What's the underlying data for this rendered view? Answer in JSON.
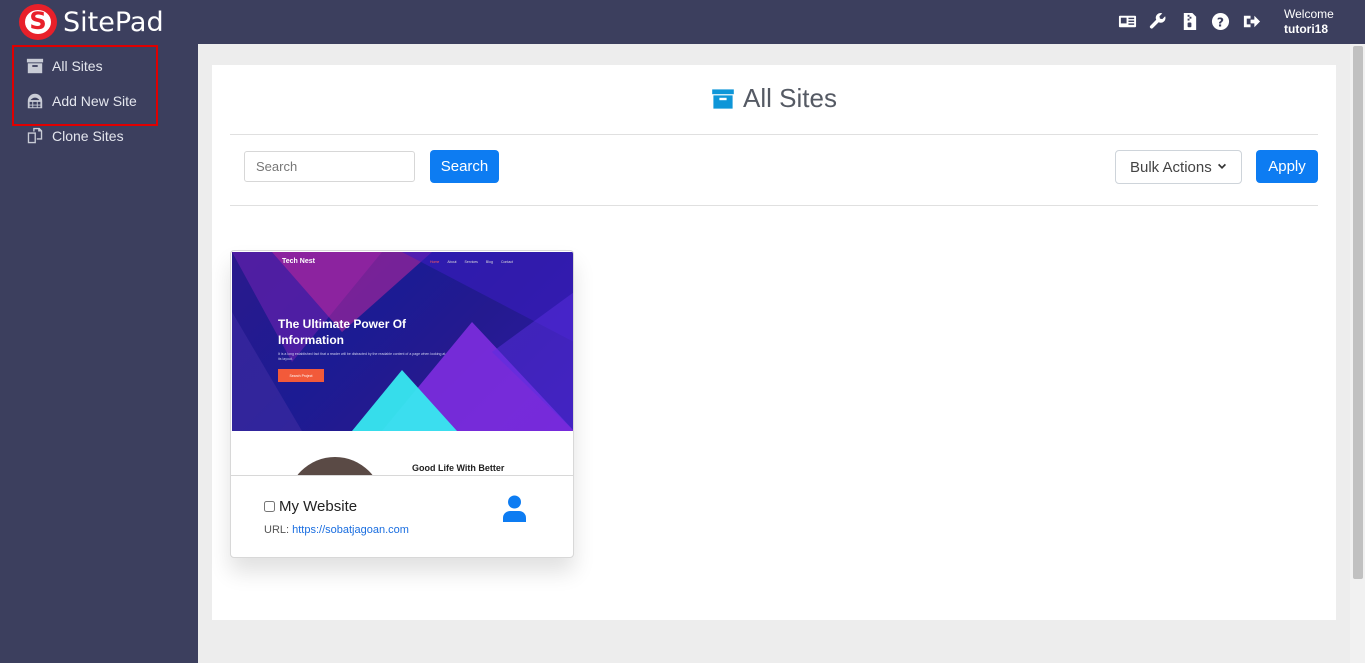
{
  "brand": {
    "name": "SitePad",
    "logo_letter": "S"
  },
  "header": {
    "welcome_label": "Welcome",
    "username": "tutori18"
  },
  "sidebar": {
    "items": [
      {
        "label": "All Sites",
        "icon": "archive-icon"
      },
      {
        "label": "Add New Site",
        "icon": "globe-grid-icon"
      },
      {
        "label": "Clone Sites",
        "icon": "clone-icon"
      }
    ]
  },
  "main": {
    "title": "All Sites",
    "search": {
      "placeholder": "Search",
      "button_label": "Search"
    },
    "bulk": {
      "selected": "Bulk Actions",
      "apply_label": "Apply"
    }
  },
  "sites": [
    {
      "name": "My Website",
      "url_label": "URL:",
      "url": "https://sobatjagoan.com",
      "preview": {
        "brand": "Tech Nest",
        "nav": [
          "Home",
          "About",
          "Services",
          "Blog",
          "Contact"
        ],
        "headline": "The Ultimate Power Of Information",
        "body": "It is a long established fact that a reader will be distracted by the readable content of a page when looking at its layout.",
        "button": "Search Project",
        "section_heading": "Good Life With Better"
      }
    }
  ],
  "colors": {
    "accent": "#0d7cf2",
    "sidebar": "#3c3f5e",
    "highlight": "#e00000",
    "brand_red": "#e8202a"
  }
}
